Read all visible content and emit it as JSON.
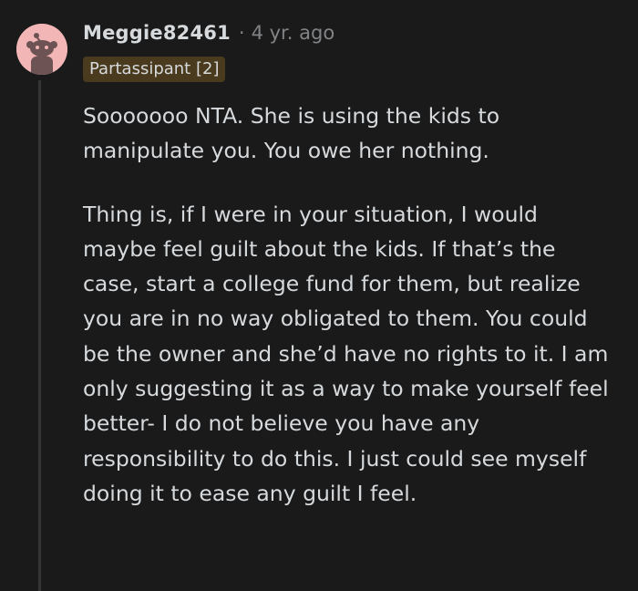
{
  "comment": {
    "username": "Meggie82461",
    "separator": "·",
    "timestamp": "4 yr. ago",
    "flair": "Partassipant [2]",
    "avatar_icon": "snoo-avatar-icon",
    "colors": {
      "background": "#1a1a1b",
      "text": "#d7dadc",
      "muted": "#818384",
      "avatar_bg": "#f3b6b6",
      "flair_bg": "#4a3a1e",
      "thread_line": "#343536"
    },
    "paragraphs": [
      "Sooooooo NTA. She is using the kids to manipulate you. You owe her nothing.",
      "Thing is, if I were in your situation, I would maybe feel guilt about the kids. If that’s the case, start a college fund for them, but realize you are in no way obligated to them. You could be the owner and she’d have no rights to it. I am only suggesting it as a way to make yourself feel better- I do not believe you have any responsibility to do this. I just could see myself doing it to ease any guilt I feel."
    ]
  }
}
